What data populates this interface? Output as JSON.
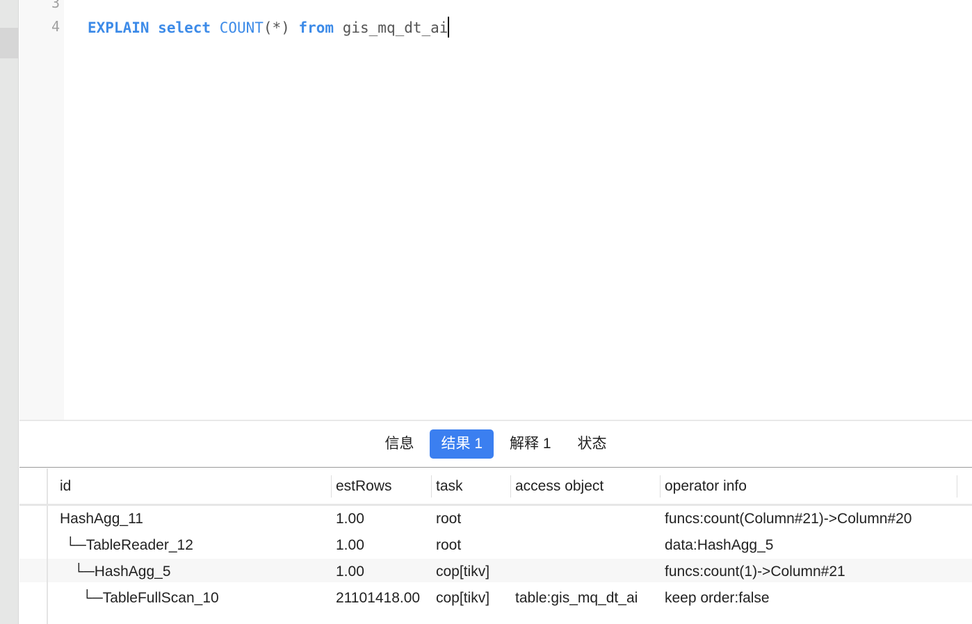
{
  "editor": {
    "line_numbers": [
      "3",
      "4"
    ],
    "code": {
      "kw1": "EXPLAIN",
      "kw2": "select",
      "fn": "COUNT",
      "args": "(*)",
      "kw3": "from",
      "table": "gis_mq_dt_ai"
    }
  },
  "tabs": [
    {
      "label": "信息"
    },
    {
      "label": "结果 1",
      "active": true
    },
    {
      "label": "解释 1"
    },
    {
      "label": "状态"
    }
  ],
  "results": {
    "columns": [
      "id",
      "estRows",
      "task",
      "access object",
      "operator info"
    ],
    "rows": [
      [
        "HashAgg_11",
        "1.00",
        "root",
        "",
        "funcs:count(Column#21)->Column#20"
      ],
      [
        "└─TableReader_12",
        "1.00",
        "root",
        "",
        "data:HashAgg_5"
      ],
      [
        "└─HashAgg_5",
        "1.00",
        "cop[tikv]",
        "",
        "funcs:count(1)->Column#21"
      ],
      [
        "└─TableFullScan_10",
        "21101418.00",
        "cop[tikv]",
        "table:gis_mq_dt_ai",
        "keep order:false"
      ]
    ]
  },
  "colors": {
    "accent": "#3b7ff0",
    "keyword": "#3d8be8"
  }
}
